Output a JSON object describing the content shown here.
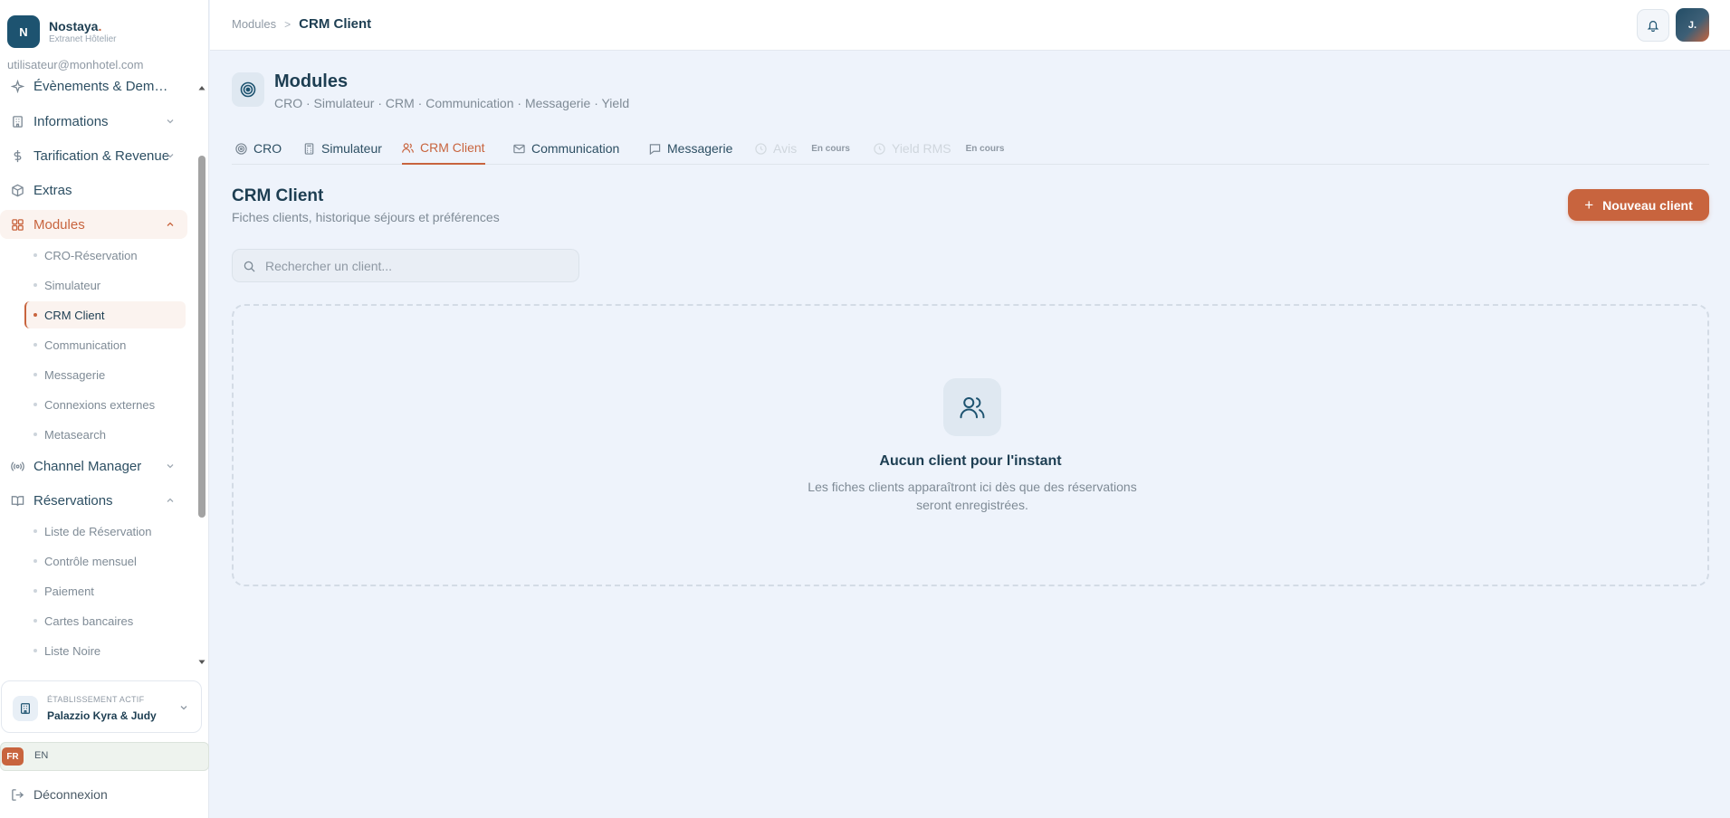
{
  "brand": {
    "initial": "N",
    "name": "Nostaya",
    "dot": ".",
    "subtitle": "Extranet Hôtelier"
  },
  "user": {
    "email": "utilisateur@monhotel.com",
    "avatar_initial": "J."
  },
  "sidebar": {
    "items": [
      {
        "label": "Évènements & Demandes",
        "icon": "sparkle-icon"
      },
      {
        "label": "Informations",
        "icon": "building-icon"
      },
      {
        "label": "Tarification & Revenue",
        "icon": "dollar-icon"
      },
      {
        "label": "Extras",
        "icon": "box-icon"
      },
      {
        "label": "Modules",
        "icon": "grid-icon"
      },
      {
        "label": "Channel Manager",
        "icon": "broadcast-icon"
      },
      {
        "label": "Réservations",
        "icon": "book-icon"
      }
    ],
    "modules_sub": [
      "CRO-Réservation",
      "Simulateur",
      "CRM Client",
      "Communication",
      "Messagerie",
      "Connexions externes",
      "Metasearch"
    ],
    "reservations_sub": [
      "Liste de Réservation",
      "Contrôle mensuel",
      "Paiement",
      "Cartes bancaires",
      "Liste Noire"
    ]
  },
  "establishment": {
    "label": "ÉTABLISSEMENT ACTIF",
    "name": "Palazzio Kyra & Judy"
  },
  "language": {
    "active": "FR",
    "other": "EN"
  },
  "logout": {
    "label": "Déconnexion"
  },
  "breadcrumb": {
    "parent": "Modules",
    "separator": ">",
    "current": "CRM Client"
  },
  "module": {
    "title": "Modules",
    "subtitle": "CRO · Simulateur · CRM · Communication · Messagerie · Yield"
  },
  "tabs": [
    {
      "label": "CRO",
      "icon": "target-icon"
    },
    {
      "label": "Simulateur",
      "icon": "calculator-icon"
    },
    {
      "label": "CRM Client",
      "icon": "users-icon"
    },
    {
      "label": "Communication",
      "icon": "mail-icon"
    },
    {
      "label": "Messagerie",
      "icon": "chat-icon"
    },
    {
      "label": "Avis",
      "icon": "star-icon",
      "badge": "En cours"
    },
    {
      "label": "Yield RMS",
      "icon": "chart-icon",
      "badge": "En cours"
    }
  ],
  "section": {
    "title": "CRM Client",
    "subtitle": "Fiches clients, historique séjours et préférences",
    "new_button": "Nouveau client",
    "new_button_icon": "+"
  },
  "search": {
    "placeholder": "Rechercher un client..."
  },
  "empty_state": {
    "title": "Aucun client pour l'instant",
    "text": "Les fiches clients apparaîtront ici dès que des réservations seront enregistrées."
  },
  "colors": {
    "accent": "#c8643e",
    "primary": "#1d5370",
    "background": "#eef3fb"
  }
}
